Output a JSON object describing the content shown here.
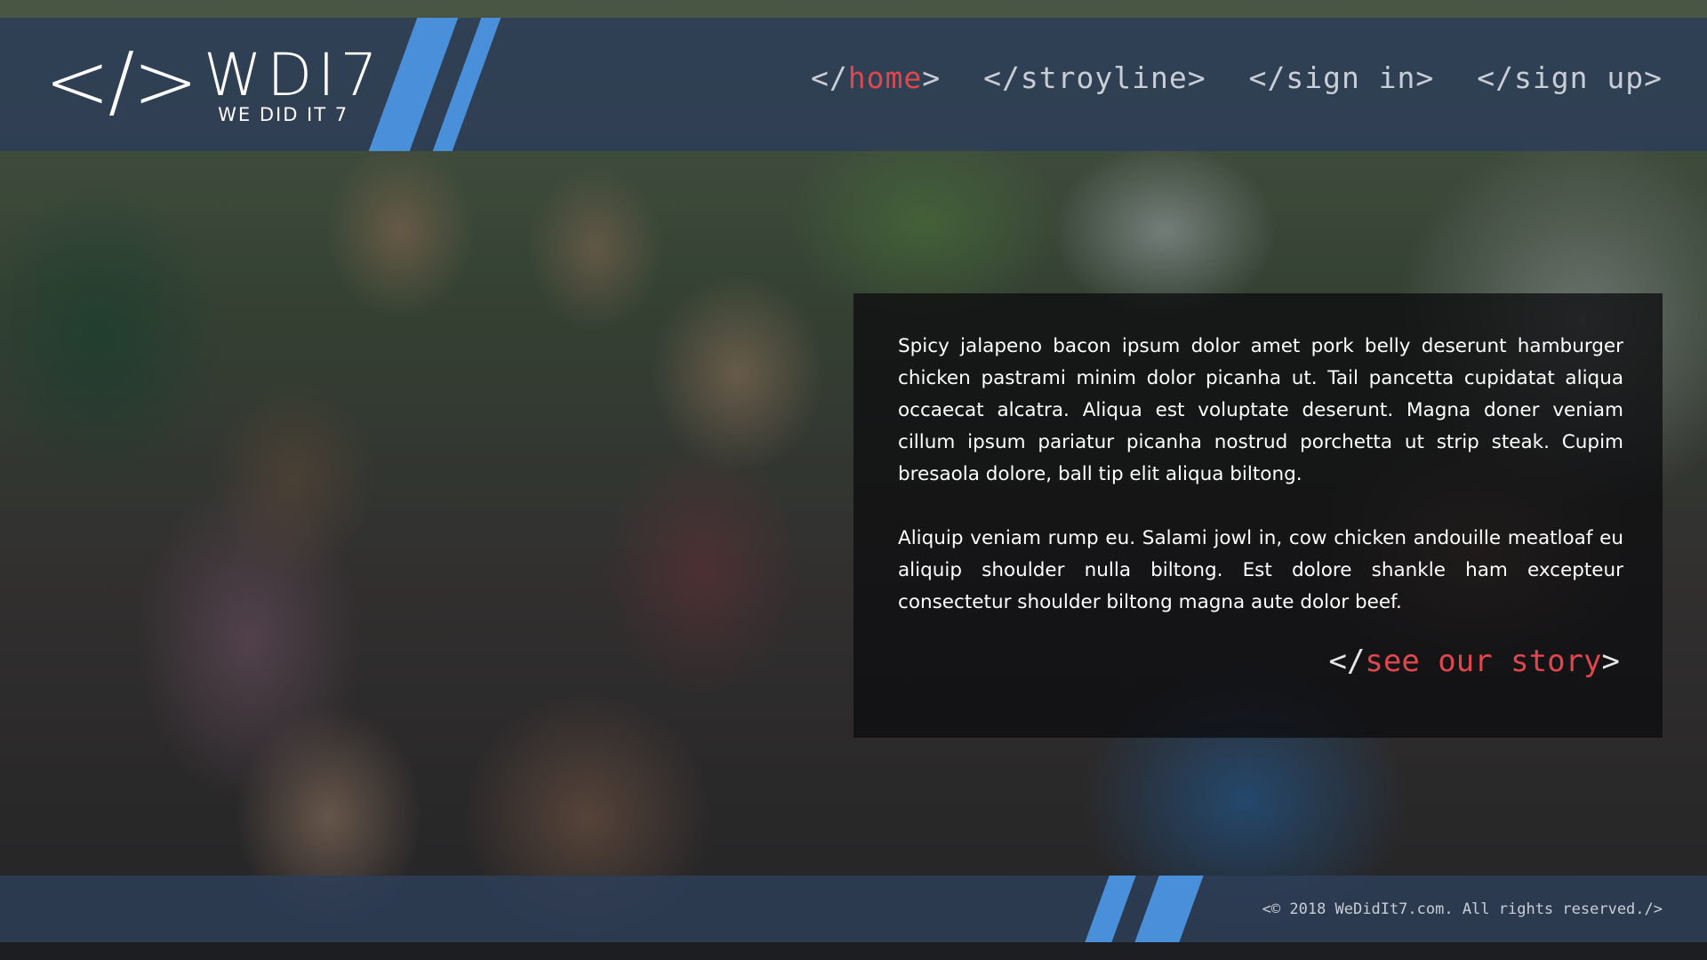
{
  "header": {
    "logo": {
      "bracket": "</>",
      "title": "WDI7",
      "subtitle": "WE DID IT 7"
    },
    "nav": [
      {
        "prefix": "</",
        "word": "home",
        "suffix": ">",
        "active": true
      },
      {
        "prefix": "</",
        "word": "stroyline",
        "suffix": ">",
        "active": false
      },
      {
        "prefix": "</",
        "word": "sign in",
        "suffix": ">",
        "active": false
      },
      {
        "prefix": "</",
        "word": "sign up",
        "suffix": ">",
        "active": false
      }
    ]
  },
  "card": {
    "paragraphs": [
      "Spicy jalapeno bacon ipsum dolor amet pork belly deserunt hamburger chicken pastrami minim dolor picanha ut. Tail pancetta cupidatat aliqua occaecat alcatra. Aliqua est voluptate deserunt. Magna doner veniam cillum ipsum pariatur picanha nostrud porchetta ut strip steak. Cupim bresaola dolore, ball tip elit aliqua biltong.",
      "Aliquip veniam rump eu. Salami jowl in, cow chicken andouille meatloaf eu aliquip shoulder nulla biltong. Est dolore shankle ham excepteur consectetur shoulder biltong magna aute dolor beef."
    ],
    "cta": {
      "prefix": "</",
      "word": "see our story",
      "suffix": ">"
    }
  },
  "footer": {
    "copyright": "<© 2018 WeDidIt7.com. All rights reserved./>"
  },
  "colors": {
    "header_bg": "#2d3e56",
    "accent_red": "#e0474d",
    "stripe_blue": "#4a8fd9",
    "nav_text": "#c9ced6"
  }
}
